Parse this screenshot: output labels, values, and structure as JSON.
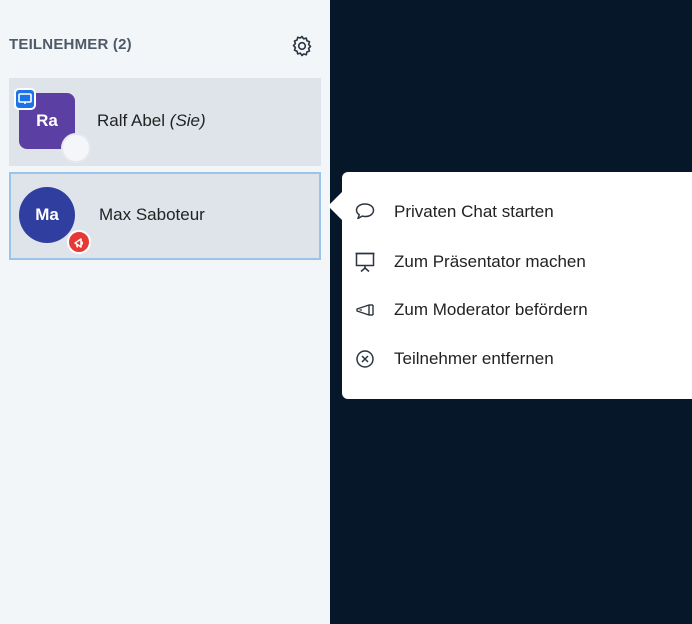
{
  "sidebar": {
    "header": {
      "title": "TEILNEHMER (2)",
      "settings_icon": "gear-icon"
    },
    "users": [
      {
        "initials": "Ra",
        "name": "Ralf Abel",
        "you_tag": "(Sie)",
        "avatar_color": "#5c3fa3",
        "avatar_shape": "rounded-square",
        "badge": "presenter-icon"
      },
      {
        "initials": "Ma",
        "name": "Max Saboteur",
        "avatar_color": "#303f9f",
        "avatar_shape": "circle",
        "badge": "moderator-icon"
      }
    ]
  },
  "context_menu": {
    "items": [
      {
        "label": "Privaten Chat starten",
        "icon": "chat-bubble-icon"
      },
      {
        "label": "Zum Präsentator machen",
        "icon": "presentation-screen-icon"
      },
      {
        "label": "Zum Moderator befördern",
        "icon": "megaphone-icon"
      },
      {
        "label": "Teilnehmer entfernen",
        "icon": "remove-circle-icon"
      }
    ]
  },
  "colors": {
    "main_background": "#06172a",
    "sidebar_background": "#f3f6f9",
    "selected_border": "#9cc3ea",
    "presenter_badge": "#1a73e8",
    "moderator_badge": "#e53935"
  }
}
